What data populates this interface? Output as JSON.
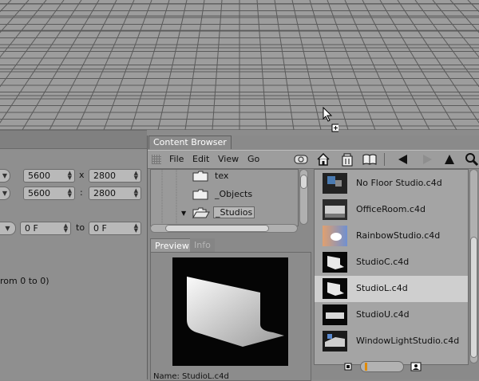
{
  "render_settings": {
    "width_value": "5600",
    "height_value": "2800",
    "film_width_value": "5600",
    "film_height_value": "2800",
    "times_sep": "x",
    "ratio_sep": ":",
    "frame_from": "0 F",
    "frame_to": "0 F",
    "to_label": "to",
    "range_note": "rom 0 to 0)"
  },
  "browser": {
    "title": "Content Browser",
    "menu": [
      "File",
      "Edit",
      "View",
      "Go"
    ],
    "tree": [
      {
        "label": "tex",
        "open": false
      },
      {
        "label": "_Objects",
        "open": false
      },
      {
        "label": "_Studios",
        "open": true
      }
    ],
    "preview_tabs": [
      "Preview",
      "Info"
    ],
    "preview_caption": "Name: StudioL.c4d",
    "items": [
      {
        "label": "No Floor Studio.c4d",
        "thumb": "nofloor"
      },
      {
        "label": "OfficeRoom.c4d",
        "thumb": "office"
      },
      {
        "label": "RainbowStudio.c4d",
        "thumb": "rainbow"
      },
      {
        "label": "StudioC.c4d",
        "thumb": "studio"
      },
      {
        "label": "StudioL.c4d",
        "thumb": "studio",
        "selected": true
      },
      {
        "label": "StudioU.c4d",
        "thumb": "studiou"
      },
      {
        "label": "WindowLightStudio.c4d",
        "thumb": "window"
      }
    ],
    "toolbar_icons": [
      "grid-view-icon",
      "home-icon",
      "trash-icon",
      "book-icon",
      "back-icon",
      "forward-icon",
      "up-icon",
      "search-icon"
    ]
  },
  "colors": {
    "viewport_bg": "#9a9a9a",
    "panel_bg": "#8a8a8a",
    "selection": "#cfcfcf",
    "accent_orange": "#e08a00"
  }
}
